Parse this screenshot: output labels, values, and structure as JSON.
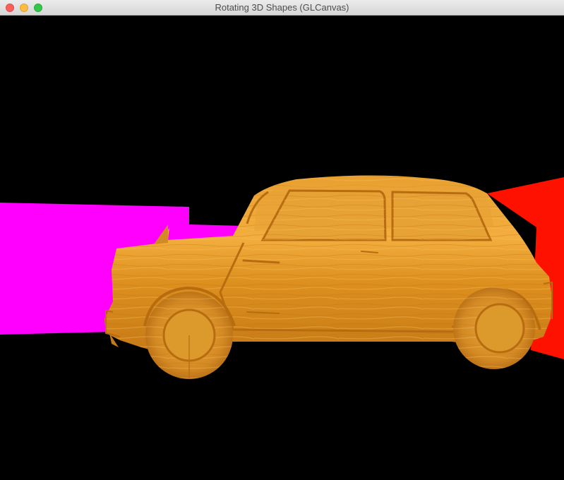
{
  "window": {
    "title": "Rotating 3D Shapes (GLCanvas)"
  },
  "colors": {
    "background": "#000000",
    "magenta_shape": "#ff00ff",
    "red_shape": "#ff1100",
    "wood_light": "#f0a838",
    "wood_mid": "#d9881c",
    "wood_dark": "#a86010"
  },
  "icons": {
    "close": "close-icon",
    "minimize": "minimize-icon",
    "zoom": "zoom-icon"
  }
}
